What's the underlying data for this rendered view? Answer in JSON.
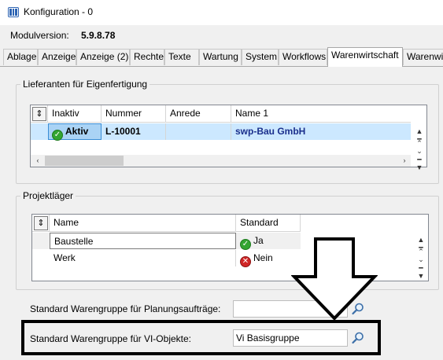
{
  "window": {
    "title": "Konfiguration - 0"
  },
  "module": {
    "label": "Modulversion:",
    "value": "5.9.8.78"
  },
  "tabs": [
    "Ablage",
    "Anzeige",
    "Anzeige (2)",
    "Rechte",
    "Texte",
    "Wartung",
    "System",
    "Workflows",
    "Warenwirtschaft",
    "Warenwi"
  ],
  "active_tab": "Warenwirtschaft",
  "suppliers": {
    "title": "Lieferanten für Eigenfertigung",
    "columns": [
      "Inaktiv",
      "Nummer",
      "Anrede",
      "Name 1"
    ],
    "rows": [
      {
        "inaktiv": "Aktiv",
        "nummer": "L-10001",
        "anrede": "",
        "name": "swp-Bau GmbH"
      }
    ]
  },
  "warehouses": {
    "title": "Projektläger",
    "columns": [
      "Name",
      "Standard"
    ],
    "rows": [
      {
        "name": "Baustelle",
        "standard": "Ja",
        "standard_ok": true
      },
      {
        "name": "Werk",
        "standard": "Nein",
        "standard_ok": false
      }
    ]
  },
  "fields": {
    "planung_label": "Standard Warengruppe für Planungsaufträge:",
    "planung_value": "",
    "vi_label": "Standard Warengruppe für VI-Objekte:",
    "vi_value": "Vi Basisgruppe"
  },
  "colors": {
    "selection": "#cce8ff",
    "selection_dark": "#aad3f5",
    "ok": "#33a532",
    "error": "#d02626",
    "annotation": "#000000"
  }
}
